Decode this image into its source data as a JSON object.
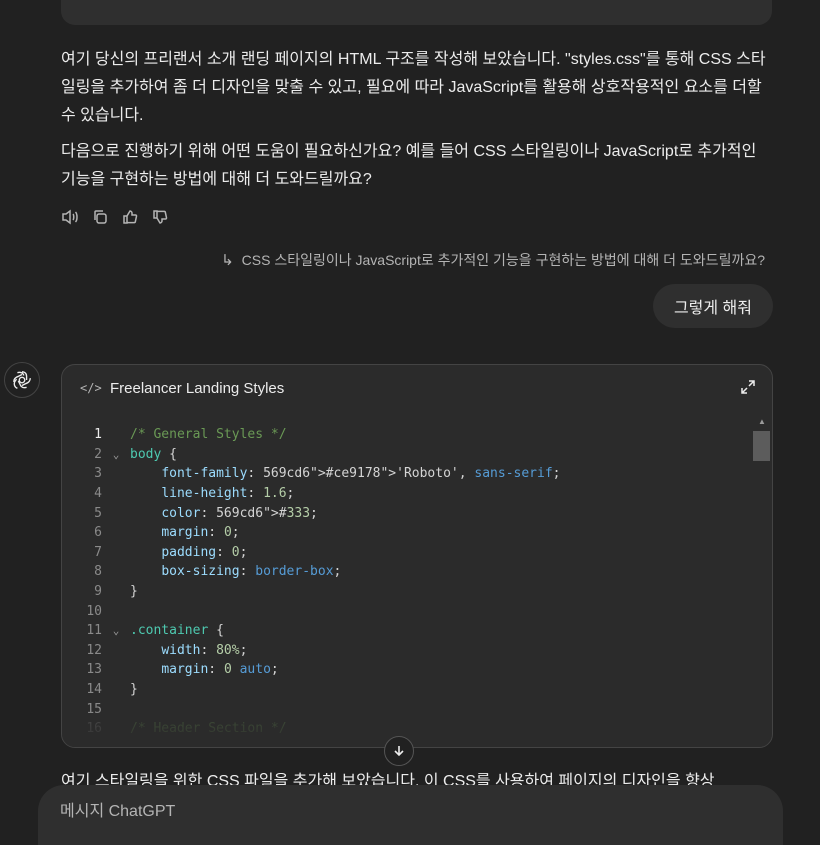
{
  "assistant_paragraphs": [
    "여기 당신의 프리랜서 소개 랜딩 페이지의 HTML 구조를 작성해 보았습니다. \"styles.css\"를 통해 CSS 스타일링을 추가하여 좀 더 디자인을 맞출 수 있고, 필요에 따라 JavaScript를 활용해 상호작용적인 요소를 더할 수 있습니다.",
    "다음으로 진행하기 위해 어떤 도움이 필요하신가요? 예를 들어 CSS 스타일링이나 JavaScript로 추가적인 기능을 구현하는 방법에 대해 더 도와드릴까요?"
  ],
  "followup": {
    "arrow": "↳",
    "text": "CSS 스타일링이나 JavaScript로 추가적인 기능을 구현하는 방법에 대해 더 도와드릴까요?"
  },
  "user_message": "그렇게 해줘",
  "canvas": {
    "code_icon": "</>",
    "title": "Freelancer Landing Styles",
    "lines": [
      {
        "n": "1",
        "fold": "",
        "t": "/* General Styles */"
      },
      {
        "n": "2",
        "fold": "v",
        "t": "body {"
      },
      {
        "n": "3",
        "fold": "",
        "t": "    font-family: 'Roboto', sans-serif;"
      },
      {
        "n": "4",
        "fold": "",
        "t": "    line-height: 1.6;"
      },
      {
        "n": "5",
        "fold": "",
        "t": "    color: #333;"
      },
      {
        "n": "6",
        "fold": "",
        "t": "    margin: 0;"
      },
      {
        "n": "7",
        "fold": "",
        "t": "    padding: 0;"
      },
      {
        "n": "8",
        "fold": "",
        "t": "    box-sizing: border-box;"
      },
      {
        "n": "9",
        "fold": "",
        "t": "}"
      },
      {
        "n": "10",
        "fold": "",
        "t": ""
      },
      {
        "n": "11",
        "fold": "v",
        "t": ".container {"
      },
      {
        "n": "12",
        "fold": "",
        "t": "    width: 80%;"
      },
      {
        "n": "13",
        "fold": "",
        "t": "    margin: 0 auto;"
      },
      {
        "n": "14",
        "fold": "",
        "t": "}"
      },
      {
        "n": "15",
        "fold": "",
        "t": ""
      },
      {
        "n": "16",
        "fold": "",
        "t": "/* Header Section */"
      }
    ]
  },
  "partial_paragraph": "여기 스타일링을 위한 CSS 파일을 추가해 보았습니다. 이 CSS를 사용하여 페이지의 디자인을 향상",
  "composer": {
    "placeholder": "메시지 ChatGPT"
  },
  "colors": {
    "background": "#212121",
    "surface": "#2f2f2f",
    "canvas": "#2b2b2b",
    "comment": "#6a9955",
    "keyword": "#4ec9b0",
    "string": "#ce9178",
    "number": "#b5cea8",
    "value_keyword": "#569cd6",
    "property": "#9cdcfe"
  }
}
